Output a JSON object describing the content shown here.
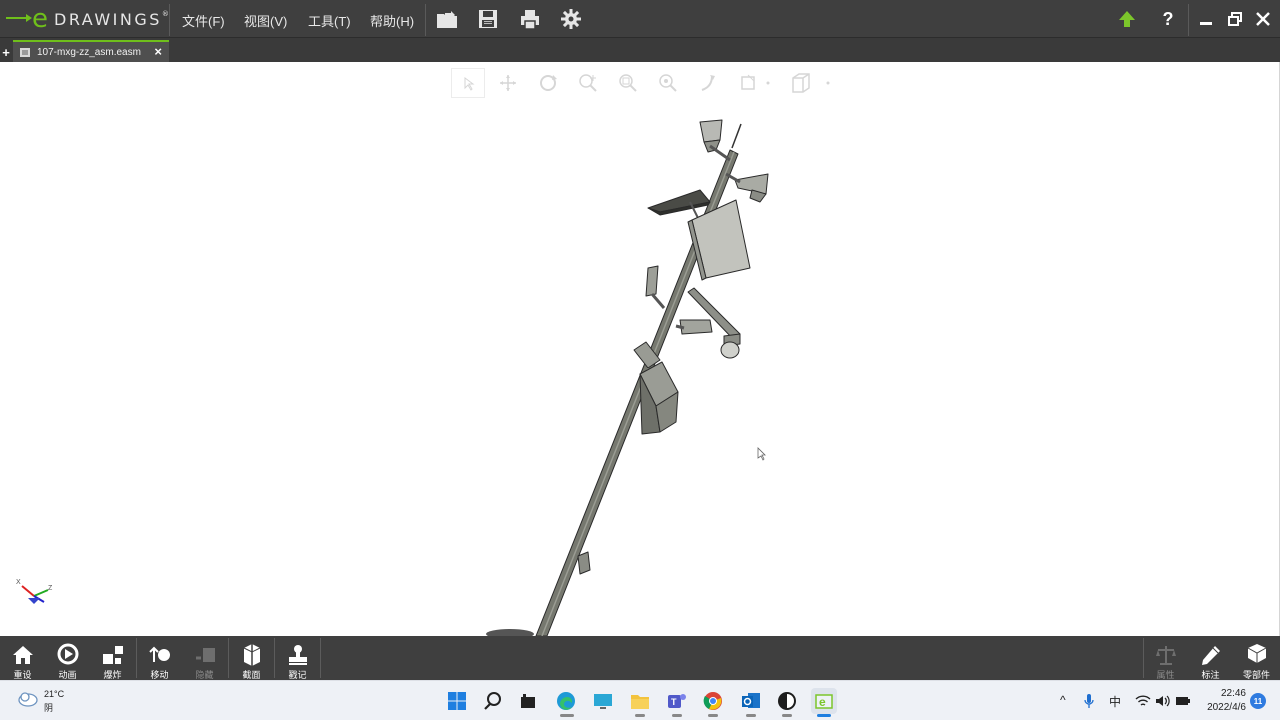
{
  "app": {
    "brand_letter": "e",
    "brand_word": "DRAWINGS",
    "brand_reg": "®"
  },
  "menu": [
    {
      "id": "file",
      "label": "文件(F)"
    },
    {
      "id": "view",
      "label": "视图(V)"
    },
    {
      "id": "tools",
      "label": "工具(T)"
    },
    {
      "id": "help",
      "label": "帮助(H)"
    }
  ],
  "toolbar_icons": [
    "open-file-icon",
    "save-icon",
    "print-icon",
    "settings-gear-icon"
  ],
  "window_icons": [
    "update-arrow-icon",
    "help-icon",
    "minimize-icon",
    "restore-icon",
    "close-icon"
  ],
  "tabs": {
    "add": "+",
    "items": [
      {
        "label": "107-mxg-zz_asm.easm",
        "close": "×"
      }
    ]
  },
  "view_toolbar_icons": [
    "select-icon",
    "pan-icon",
    "rotate-icon",
    "zoom-icon",
    "zoom-area-icon",
    "zoom-fit-icon",
    "turn-camera-icon",
    "view-orientation-icon",
    "display-style-icon"
  ],
  "triad": {
    "x": "X",
    "z": "Z"
  },
  "bottom_tools": [
    {
      "id": "home",
      "label": "重设",
      "enabled": true
    },
    {
      "id": "animate",
      "label": "动画",
      "enabled": true
    },
    {
      "id": "explode",
      "label": "爆炸",
      "enabled": true
    },
    {
      "id": "move",
      "label": "移动",
      "enabled": true
    },
    {
      "id": "hide",
      "label": "隐藏",
      "enabled": false
    },
    {
      "id": "section",
      "label": "截面",
      "enabled": true
    },
    {
      "id": "stamp",
      "label": "戳记",
      "enabled": true
    }
  ],
  "bottom_right_tools": [
    {
      "id": "properties",
      "label": "属性",
      "enabled": false
    },
    {
      "id": "markup",
      "label": "标注",
      "enabled": true
    },
    {
      "id": "components",
      "label": "零部件",
      "enabled": true
    }
  ],
  "taskbar": {
    "weather_temp": "21°C",
    "weather_desc": "阴",
    "apps": [
      "windows-start-icon",
      "search-icon",
      "file-manager-icon",
      "edge-browser-icon",
      "monitor-icon",
      "folder-icon",
      "teams-icon",
      "chrome-icon",
      "outlook-icon",
      "media-app-icon",
      "edrawings-app-icon"
    ],
    "tray_caret": "^",
    "ime": "中",
    "time": "22:46",
    "date": "2022/4/6",
    "notifications": "11"
  }
}
